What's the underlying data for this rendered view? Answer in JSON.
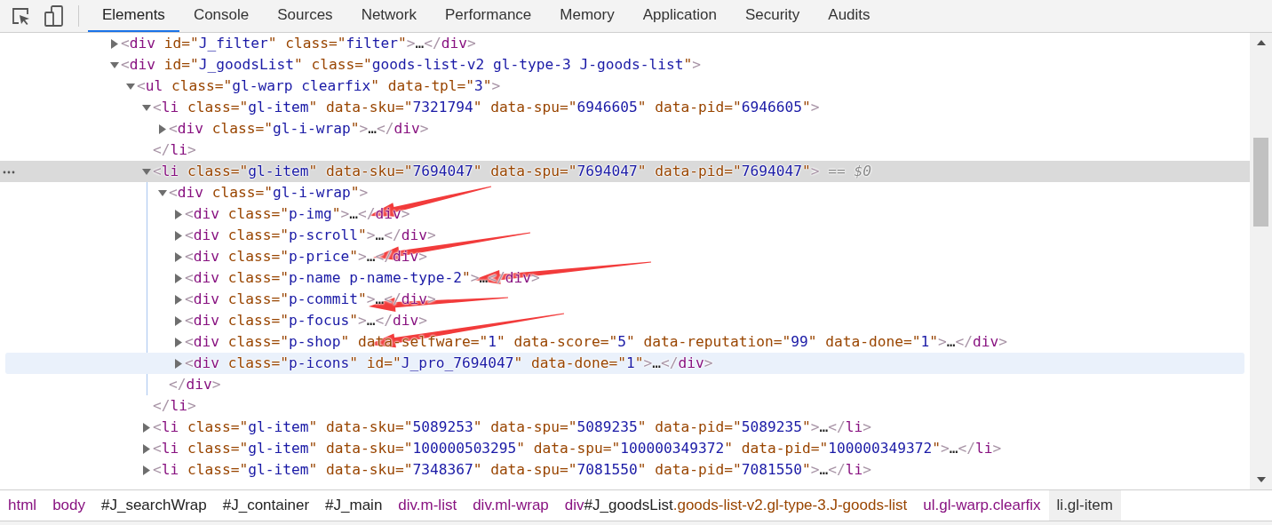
{
  "toolbar": {
    "tabs": [
      {
        "label": "Elements",
        "selected": true
      },
      {
        "label": "Console",
        "selected": false
      },
      {
        "label": "Sources",
        "selected": false
      },
      {
        "label": "Network",
        "selected": false
      },
      {
        "label": "Performance",
        "selected": false
      },
      {
        "label": "Memory",
        "selected": false
      },
      {
        "label": "Application",
        "selected": false
      },
      {
        "label": "Security",
        "selected": false
      },
      {
        "label": "Audits",
        "selected": false
      }
    ]
  },
  "tree": {
    "nodes": [
      {
        "expanded": false,
        "selected": false,
        "hovered": false,
        "line": [
          {
            "kind": "bracket",
            "text": "<"
          },
          {
            "kind": "tag",
            "text": "div"
          },
          {
            "kind": "attr",
            "text": " id=\""
          },
          {
            "kind": "value",
            "text": "J_filter"
          },
          {
            "kind": "attr",
            "text": "\" class=\""
          },
          {
            "kind": "value",
            "text": "filter"
          },
          {
            "kind": "attr",
            "text": "\""
          },
          {
            "kind": "bracket",
            "text": ">"
          },
          {
            "kind": "text",
            "text": "…"
          },
          {
            "kind": "bracket",
            "text": "</"
          },
          {
            "kind": "tag",
            "text": "div"
          },
          {
            "kind": "bracket",
            "text": ">"
          }
        ]
      },
      {
        "expanded": true,
        "selected": false,
        "hovered": false,
        "line": [
          {
            "kind": "bracket",
            "text": "<"
          },
          {
            "kind": "tag",
            "text": "div"
          },
          {
            "kind": "attr",
            "text": " id=\""
          },
          {
            "kind": "value",
            "text": "J_goodsList"
          },
          {
            "kind": "attr",
            "text": "\" class=\""
          },
          {
            "kind": "value",
            "text": "goods-list-v2 gl-type-3 J-goods-list"
          },
          {
            "kind": "attr",
            "text": "\""
          },
          {
            "kind": "bracket",
            "text": ">"
          }
        ],
        "children": [
          {
            "expanded": true,
            "selected": false,
            "hovered": false,
            "line": [
              {
                "kind": "bracket",
                "text": "<"
              },
              {
                "kind": "tag",
                "text": "ul"
              },
              {
                "kind": "attr",
                "text": " class=\""
              },
              {
                "kind": "value",
                "text": "gl-warp clearfix"
              },
              {
                "kind": "attr",
                "text": "\" data-tpl=\""
              },
              {
                "kind": "value",
                "text": "3"
              },
              {
                "kind": "attr",
                "text": "\""
              },
              {
                "kind": "bracket",
                "text": ">"
              }
            ],
            "children": [
              {
                "expanded": true,
                "selected": false,
                "hovered": false,
                "line": [
                  {
                    "kind": "bracket",
                    "text": "<"
                  },
                  {
                    "kind": "tag",
                    "text": "li"
                  },
                  {
                    "kind": "attr",
                    "text": " class=\""
                  },
                  {
                    "kind": "value",
                    "text": "gl-item"
                  },
                  {
                    "kind": "attr",
                    "text": "\" data-sku=\""
                  },
                  {
                    "kind": "value",
                    "text": "7321794"
                  },
                  {
                    "kind": "attr",
                    "text": "\" data-spu=\""
                  },
                  {
                    "kind": "value",
                    "text": "6946605"
                  },
                  {
                    "kind": "attr",
                    "text": "\" data-pid=\""
                  },
                  {
                    "kind": "value",
                    "text": "6946605"
                  },
                  {
                    "kind": "attr",
                    "text": "\""
                  },
                  {
                    "kind": "bracket",
                    "text": ">"
                  }
                ],
                "children": [
                  {
                    "expanded": false,
                    "selected": false,
                    "hovered": false,
                    "line": [
                      {
                        "kind": "bracket",
                        "text": "<"
                      },
                      {
                        "kind": "tag",
                        "text": "div"
                      },
                      {
                        "kind": "attr",
                        "text": " class=\""
                      },
                      {
                        "kind": "value",
                        "text": "gl-i-wrap"
                      },
                      {
                        "kind": "attr",
                        "text": "\""
                      },
                      {
                        "kind": "bracket",
                        "text": ">"
                      },
                      {
                        "kind": "text",
                        "text": "…"
                      },
                      {
                        "kind": "bracket",
                        "text": "</"
                      },
                      {
                        "kind": "tag",
                        "text": "div"
                      },
                      {
                        "kind": "bracket",
                        "text": ">"
                      }
                    ]
                  }
                ],
                "close": [
                  {
                    "kind": "bracket",
                    "text": "</"
                  },
                  {
                    "kind": "tag",
                    "text": "li"
                  },
                  {
                    "kind": "bracket",
                    "text": ">"
                  }
                ]
              },
              {
                "expanded": true,
                "selected": true,
                "hovered": false,
                "line": [
                  {
                    "kind": "bracket",
                    "text": "<"
                  },
                  {
                    "kind": "tag",
                    "text": "li"
                  },
                  {
                    "kind": "attr",
                    "text": " class=\""
                  },
                  {
                    "kind": "value",
                    "text": "gl-item"
                  },
                  {
                    "kind": "attr",
                    "text": "\" data-sku=\""
                  },
                  {
                    "kind": "value",
                    "text": "7694047"
                  },
                  {
                    "kind": "attr",
                    "text": "\" data-spu=\""
                  },
                  {
                    "kind": "value",
                    "text": "7694047"
                  },
                  {
                    "kind": "attr",
                    "text": "\" data-pid=\""
                  },
                  {
                    "kind": "value",
                    "text": "7694047"
                  },
                  {
                    "kind": "attr",
                    "text": "\""
                  },
                  {
                    "kind": "bracket",
                    "text": ">"
                  },
                  {
                    "kind": "hint",
                    "text": " == "
                  },
                  {
                    "kind": "hint-var",
                    "text": "$0"
                  }
                ],
                "children": [
                  {
                    "expanded": true,
                    "selected": false,
                    "hovered": false,
                    "line": [
                      {
                        "kind": "bracket",
                        "text": "<"
                      },
                      {
                        "kind": "tag",
                        "text": "div"
                      },
                      {
                        "kind": "attr",
                        "text": " class=\""
                      },
                      {
                        "kind": "value",
                        "text": "gl-i-wrap"
                      },
                      {
                        "kind": "attr",
                        "text": "\""
                      },
                      {
                        "kind": "bracket",
                        "text": ">"
                      }
                    ],
                    "children": [
                      {
                        "expanded": false,
                        "selected": false,
                        "hovered": false,
                        "line": [
                          {
                            "kind": "bracket",
                            "text": "<"
                          },
                          {
                            "kind": "tag",
                            "text": "div"
                          },
                          {
                            "kind": "attr",
                            "text": " class=\""
                          },
                          {
                            "kind": "value",
                            "text": "p-img"
                          },
                          {
                            "kind": "attr",
                            "text": "\""
                          },
                          {
                            "kind": "bracket",
                            "text": ">"
                          },
                          {
                            "kind": "text",
                            "text": "…"
                          },
                          {
                            "kind": "bracket",
                            "text": "</"
                          },
                          {
                            "kind": "tag",
                            "text": "div"
                          },
                          {
                            "kind": "bracket",
                            "text": ">"
                          }
                        ]
                      },
                      {
                        "expanded": false,
                        "selected": false,
                        "hovered": false,
                        "line": [
                          {
                            "kind": "bracket",
                            "text": "<"
                          },
                          {
                            "kind": "tag",
                            "text": "div"
                          },
                          {
                            "kind": "attr",
                            "text": " class=\""
                          },
                          {
                            "kind": "value",
                            "text": "p-scroll"
                          },
                          {
                            "kind": "attr",
                            "text": "\""
                          },
                          {
                            "kind": "bracket",
                            "text": ">"
                          },
                          {
                            "kind": "text",
                            "text": "…"
                          },
                          {
                            "kind": "bracket",
                            "text": "</"
                          },
                          {
                            "kind": "tag",
                            "text": "div"
                          },
                          {
                            "kind": "bracket",
                            "text": ">"
                          }
                        ]
                      },
                      {
                        "expanded": false,
                        "selected": false,
                        "hovered": false,
                        "line": [
                          {
                            "kind": "bracket",
                            "text": "<"
                          },
                          {
                            "kind": "tag",
                            "text": "div"
                          },
                          {
                            "kind": "attr",
                            "text": " class=\""
                          },
                          {
                            "kind": "value",
                            "text": "p-price"
                          },
                          {
                            "kind": "attr",
                            "text": "\""
                          },
                          {
                            "kind": "bracket",
                            "text": ">"
                          },
                          {
                            "kind": "text",
                            "text": "…"
                          },
                          {
                            "kind": "bracket",
                            "text": "</"
                          },
                          {
                            "kind": "tag",
                            "text": "div"
                          },
                          {
                            "kind": "bracket",
                            "text": ">"
                          }
                        ]
                      },
                      {
                        "expanded": false,
                        "selected": false,
                        "hovered": false,
                        "line": [
                          {
                            "kind": "bracket",
                            "text": "<"
                          },
                          {
                            "kind": "tag",
                            "text": "div"
                          },
                          {
                            "kind": "attr",
                            "text": " class=\""
                          },
                          {
                            "kind": "value",
                            "text": "p-name p-name-type-2"
                          },
                          {
                            "kind": "attr",
                            "text": "\""
                          },
                          {
                            "kind": "bracket",
                            "text": ">"
                          },
                          {
                            "kind": "text",
                            "text": "…"
                          },
                          {
                            "kind": "bracket",
                            "text": "</"
                          },
                          {
                            "kind": "tag",
                            "text": "div"
                          },
                          {
                            "kind": "bracket",
                            "text": ">"
                          }
                        ]
                      },
                      {
                        "expanded": false,
                        "selected": false,
                        "hovered": false,
                        "line": [
                          {
                            "kind": "bracket",
                            "text": "<"
                          },
                          {
                            "kind": "tag",
                            "text": "div"
                          },
                          {
                            "kind": "attr",
                            "text": " class=\""
                          },
                          {
                            "kind": "value",
                            "text": "p-commit"
                          },
                          {
                            "kind": "attr",
                            "text": "\""
                          },
                          {
                            "kind": "bracket",
                            "text": ">"
                          },
                          {
                            "kind": "text",
                            "text": "…"
                          },
                          {
                            "kind": "bracket",
                            "text": "</"
                          },
                          {
                            "kind": "tag",
                            "text": "div"
                          },
                          {
                            "kind": "bracket",
                            "text": ">"
                          }
                        ]
                      },
                      {
                        "expanded": false,
                        "selected": false,
                        "hovered": false,
                        "line": [
                          {
                            "kind": "bracket",
                            "text": "<"
                          },
                          {
                            "kind": "tag",
                            "text": "div"
                          },
                          {
                            "kind": "attr",
                            "text": " class=\""
                          },
                          {
                            "kind": "value",
                            "text": "p-focus"
                          },
                          {
                            "kind": "attr",
                            "text": "\""
                          },
                          {
                            "kind": "bracket",
                            "text": ">"
                          },
                          {
                            "kind": "text",
                            "text": "…"
                          },
                          {
                            "kind": "bracket",
                            "text": "</"
                          },
                          {
                            "kind": "tag",
                            "text": "div"
                          },
                          {
                            "kind": "bracket",
                            "text": ">"
                          }
                        ]
                      },
                      {
                        "expanded": false,
                        "selected": false,
                        "hovered": false,
                        "line": [
                          {
                            "kind": "bracket",
                            "text": "<"
                          },
                          {
                            "kind": "tag",
                            "text": "div"
                          },
                          {
                            "kind": "attr",
                            "text": " class=\""
                          },
                          {
                            "kind": "value",
                            "text": "p-shop"
                          },
                          {
                            "kind": "attr",
                            "text": "\" data-selfware=\""
                          },
                          {
                            "kind": "value",
                            "text": "1"
                          },
                          {
                            "kind": "attr",
                            "text": "\" data-score=\""
                          },
                          {
                            "kind": "value",
                            "text": "5"
                          },
                          {
                            "kind": "attr",
                            "text": "\" data-reputation=\""
                          },
                          {
                            "kind": "value",
                            "text": "99"
                          },
                          {
                            "kind": "attr",
                            "text": "\" data-done=\""
                          },
                          {
                            "kind": "value",
                            "text": "1"
                          },
                          {
                            "kind": "attr",
                            "text": "\""
                          },
                          {
                            "kind": "bracket",
                            "text": ">"
                          },
                          {
                            "kind": "text",
                            "text": "…"
                          },
                          {
                            "kind": "bracket",
                            "text": "</"
                          },
                          {
                            "kind": "tag",
                            "text": "div"
                          },
                          {
                            "kind": "bracket",
                            "text": ">"
                          }
                        ]
                      },
                      {
                        "expanded": false,
                        "selected": false,
                        "hovered": true,
                        "line": [
                          {
                            "kind": "bracket",
                            "text": "<"
                          },
                          {
                            "kind": "tag",
                            "text": "div"
                          },
                          {
                            "kind": "attr",
                            "text": " class=\""
                          },
                          {
                            "kind": "value",
                            "text": "p-icons"
                          },
                          {
                            "kind": "attr",
                            "text": "\" id=\""
                          },
                          {
                            "kind": "value",
                            "text": "J_pro_7694047"
                          },
                          {
                            "kind": "attr",
                            "text": "\" data-done=\""
                          },
                          {
                            "kind": "value",
                            "text": "1"
                          },
                          {
                            "kind": "attr",
                            "text": "\""
                          },
                          {
                            "kind": "bracket",
                            "text": ">"
                          },
                          {
                            "kind": "text",
                            "text": "…"
                          },
                          {
                            "kind": "bracket",
                            "text": "</"
                          },
                          {
                            "kind": "tag",
                            "text": "div"
                          },
                          {
                            "kind": "bracket",
                            "text": ">"
                          }
                        ]
                      }
                    ],
                    "close": [
                      {
                        "kind": "bracket",
                        "text": "</"
                      },
                      {
                        "kind": "tag",
                        "text": "div"
                      },
                      {
                        "kind": "bracket",
                        "text": ">"
                      }
                    ]
                  }
                ],
                "close": [
                  {
                    "kind": "bracket",
                    "text": "</"
                  },
                  {
                    "kind": "tag",
                    "text": "li"
                  },
                  {
                    "kind": "bracket",
                    "text": ">"
                  }
                ]
              },
              {
                "expanded": false,
                "selected": false,
                "hovered": false,
                "line": [
                  {
                    "kind": "bracket",
                    "text": "<"
                  },
                  {
                    "kind": "tag",
                    "text": "li"
                  },
                  {
                    "kind": "attr",
                    "text": " class=\""
                  },
                  {
                    "kind": "value",
                    "text": "gl-item"
                  },
                  {
                    "kind": "attr",
                    "text": "\" data-sku=\""
                  },
                  {
                    "kind": "value",
                    "text": "5089253"
                  },
                  {
                    "kind": "attr",
                    "text": "\" data-spu=\""
                  },
                  {
                    "kind": "value",
                    "text": "5089235"
                  },
                  {
                    "kind": "attr",
                    "text": "\" data-pid=\""
                  },
                  {
                    "kind": "value",
                    "text": "5089235"
                  },
                  {
                    "kind": "attr",
                    "text": "\""
                  },
                  {
                    "kind": "bracket",
                    "text": ">"
                  },
                  {
                    "kind": "text",
                    "text": "…"
                  },
                  {
                    "kind": "bracket",
                    "text": "</"
                  },
                  {
                    "kind": "tag",
                    "text": "li"
                  },
                  {
                    "kind": "bracket",
                    "text": ">"
                  }
                ]
              },
              {
                "expanded": false,
                "selected": false,
                "hovered": false,
                "line": [
                  {
                    "kind": "bracket",
                    "text": "<"
                  },
                  {
                    "kind": "tag",
                    "text": "li"
                  },
                  {
                    "kind": "attr",
                    "text": " class=\""
                  },
                  {
                    "kind": "value",
                    "text": "gl-item"
                  },
                  {
                    "kind": "attr",
                    "text": "\" data-sku=\""
                  },
                  {
                    "kind": "value",
                    "text": "100000503295"
                  },
                  {
                    "kind": "attr",
                    "text": "\" data-spu=\""
                  },
                  {
                    "kind": "value",
                    "text": "100000349372"
                  },
                  {
                    "kind": "attr",
                    "text": "\" data-pid=\""
                  },
                  {
                    "kind": "value",
                    "text": "100000349372"
                  },
                  {
                    "kind": "attr",
                    "text": "\""
                  },
                  {
                    "kind": "bracket",
                    "text": ">"
                  },
                  {
                    "kind": "text",
                    "text": "…"
                  },
                  {
                    "kind": "bracket",
                    "text": "</"
                  },
                  {
                    "kind": "tag",
                    "text": "li"
                  },
                  {
                    "kind": "bracket",
                    "text": ">"
                  }
                ]
              },
              {
                "expanded": false,
                "selected": false,
                "hovered": false,
                "line": [
                  {
                    "kind": "bracket",
                    "text": "<"
                  },
                  {
                    "kind": "tag",
                    "text": "li"
                  },
                  {
                    "kind": "attr",
                    "text": " class=\""
                  },
                  {
                    "kind": "value",
                    "text": "gl-item"
                  },
                  {
                    "kind": "attr",
                    "text": "\" data-sku=\""
                  },
                  {
                    "kind": "value",
                    "text": "7348367"
                  },
                  {
                    "kind": "attr",
                    "text": "\" data-spu=\""
                  },
                  {
                    "kind": "value",
                    "text": "7081550"
                  },
                  {
                    "kind": "attr",
                    "text": "\" data-pid=\""
                  },
                  {
                    "kind": "value",
                    "text": "7081550"
                  },
                  {
                    "kind": "attr",
                    "text": "\""
                  },
                  {
                    "kind": "bracket",
                    "text": ">"
                  },
                  {
                    "kind": "text",
                    "text": "…"
                  },
                  {
                    "kind": "bracket",
                    "text": "</"
                  },
                  {
                    "kind": "tag",
                    "text": "li"
                  },
                  {
                    "kind": "bracket",
                    "text": ">"
                  }
                ]
              }
            ]
          }
        ]
      }
    ]
  },
  "breadcrumbs": [
    {
      "selected": false,
      "parts": [
        {
          "kind": "tag",
          "text": "html"
        }
      ]
    },
    {
      "selected": false,
      "parts": [
        {
          "kind": "tag",
          "text": "body"
        }
      ]
    },
    {
      "selected": false,
      "parts": [
        {
          "kind": "id",
          "text": "#J_searchWrap"
        }
      ]
    },
    {
      "selected": false,
      "parts": [
        {
          "kind": "id",
          "text": "#J_container"
        }
      ]
    },
    {
      "selected": false,
      "parts": [
        {
          "kind": "id",
          "text": "#J_main"
        }
      ]
    },
    {
      "selected": false,
      "parts": [
        {
          "kind": "tag",
          "text": "div.m-list"
        }
      ]
    },
    {
      "selected": false,
      "parts": [
        {
          "kind": "tag",
          "text": "div.ml-wrap"
        }
      ]
    },
    {
      "selected": false,
      "parts": [
        {
          "kind": "tag",
          "text": "div"
        },
        {
          "kind": "id",
          "text": "#J_goodsList"
        },
        {
          "kind": "class",
          "text": ".goods-list-v2.gl-type-3.J-goods-list"
        }
      ]
    },
    {
      "selected": false,
      "parts": [
        {
          "kind": "tag",
          "text": "ul.gl-warp.clearfix"
        }
      ]
    },
    {
      "selected": true,
      "parts": [
        {
          "kind": "tag",
          "text": "li.gl-item"
        }
      ]
    }
  ]
}
